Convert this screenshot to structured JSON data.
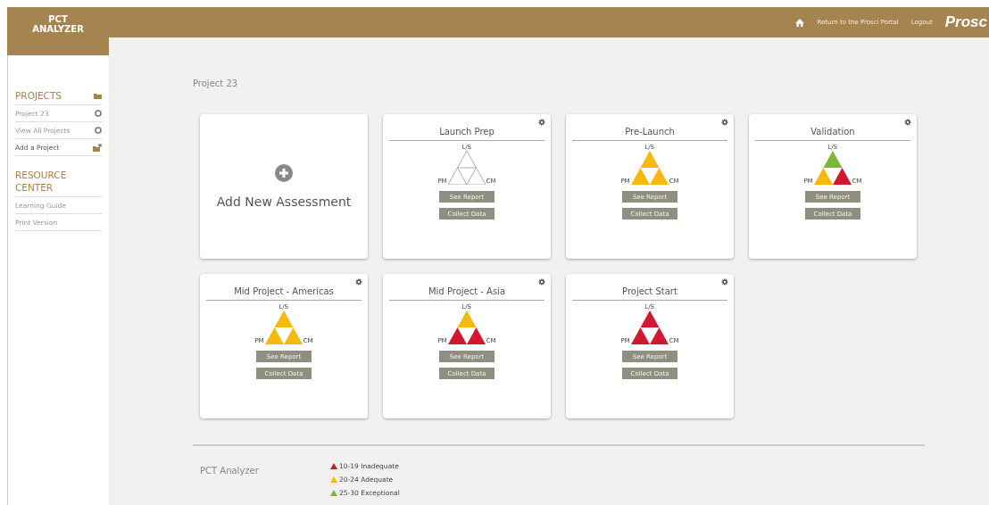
{
  "app_title": "PCT\nANALYZER",
  "nav": {
    "links": [
      "Return to the Prosci Portal",
      "Logout"
    ],
    "brand": "Prosc"
  },
  "sidebar": {
    "sections": [
      {
        "heading": "PROJECTS",
        "items": [
          {
            "label": "Project 23",
            "kind": "circle",
            "selected": false
          },
          {
            "label": "View All Projects",
            "kind": "circle",
            "selected": false
          },
          {
            "label": "Add a Project",
            "kind": "add",
            "selected": true
          }
        ]
      },
      {
        "heading": "RESOURCE CENTER",
        "items": [
          {
            "label": "Learning Guide",
            "kind": "plain",
            "selected": false
          },
          {
            "label": "Print Version",
            "kind": "plain",
            "selected": false
          }
        ]
      }
    ]
  },
  "page_title": "Project 23",
  "add_card": {
    "label": "Add New Assessment"
  },
  "assessments": [
    {
      "title": "Launch Prep",
      "segments": [
        {
          "label": "L/S",
          "color": "#ffffff"
        },
        {
          "label": "PM",
          "color": "#ffffff"
        },
        {
          "label": "CM",
          "color": "#ffffff"
        }
      ],
      "buttons": [
        "See Report",
        "Collect Data"
      ]
    },
    {
      "title": "Pre-Launch",
      "segments": [
        {
          "label": "L/S",
          "color": "#f5b90f"
        },
        {
          "label": "PM",
          "color": "#f5b90f"
        },
        {
          "label": "CM",
          "color": "#f5b90f"
        }
      ],
      "buttons": [
        "See Report",
        "Collect Data"
      ]
    },
    {
      "title": "Validation",
      "segments": [
        {
          "label": "L/S",
          "color": "#7ab73a"
        },
        {
          "label": "PM",
          "color": "#f5b90f"
        },
        {
          "label": "CM",
          "color": "#d0182f"
        }
      ],
      "buttons": [
        "See Report",
        "Collect Data"
      ]
    },
    {
      "title": "Mid Project - Americas",
      "segments": [
        {
          "label": "L/S",
          "color": "#f5b90f"
        },
        {
          "label": "PM",
          "color": "#f5b90f"
        },
        {
          "label": "CM",
          "color": "#f5b90f"
        }
      ],
      "buttons": [
        "See Report",
        "Collect Data"
      ]
    },
    {
      "title": "Mid Project - Asia",
      "segments": [
        {
          "label": "L/S",
          "color": "#f5b90f"
        },
        {
          "label": "PM",
          "color": "#d0182f"
        },
        {
          "label": "CM",
          "color": "#d0182f"
        }
      ],
      "buttons": [
        "See Report",
        "Collect Data"
      ]
    },
    {
      "title": "Project Start",
      "segments": [
        {
          "label": "L/S",
          "color": "#d0182f"
        },
        {
          "label": "PM",
          "color": "#d0182f"
        },
        {
          "label": "CM",
          "color": "#d0182f"
        }
      ],
      "buttons": [
        "See Report",
        "Collect Data"
      ]
    }
  ],
  "footer": {
    "title": "PCT Analyzer",
    "legend": [
      {
        "label": "10-19 Inadequate",
        "color": "#d0182f"
      },
      {
        "label": "20-24 Adequate",
        "color": "#f5b90f"
      },
      {
        "label": "25-30 Exceptional",
        "color": "#7ab73a"
      }
    ]
  }
}
